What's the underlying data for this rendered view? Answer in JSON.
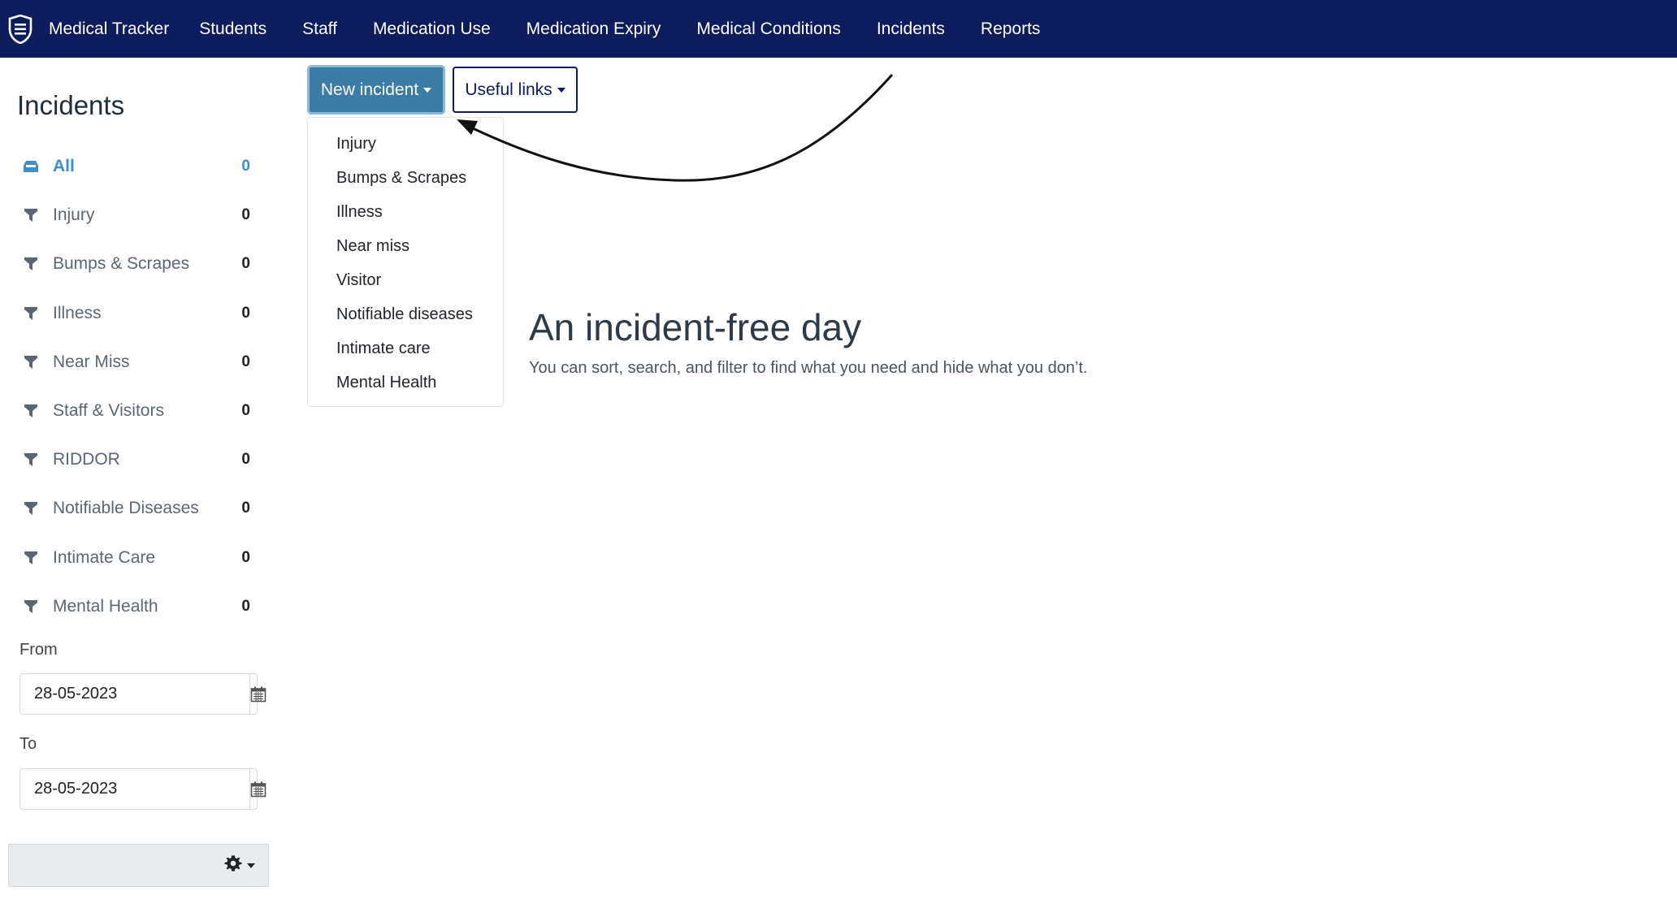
{
  "navbar": {
    "brand": "Medical Tracker",
    "items": [
      "Students",
      "Staff",
      "Medication Use",
      "Medication Expiry",
      "Medical Conditions",
      "Incidents",
      "Reports"
    ]
  },
  "sidebar": {
    "title": "Incidents",
    "filters": [
      {
        "label": "All",
        "count": "0",
        "icon": "inbox-icon"
      },
      {
        "label": "Injury",
        "count": "0",
        "icon": "filter-icon"
      },
      {
        "label": "Bumps & Scrapes",
        "count": "0",
        "icon": "filter-icon"
      },
      {
        "label": "Illness",
        "count": "0",
        "icon": "filter-icon"
      },
      {
        "label": "Near Miss",
        "count": "0",
        "icon": "filter-icon"
      },
      {
        "label": "Staff & Visitors",
        "count": "0",
        "icon": "filter-icon"
      },
      {
        "label": "RIDDOR",
        "count": "0",
        "icon": "filter-icon"
      },
      {
        "label": "Notifiable Diseases",
        "count": "0",
        "icon": "filter-icon"
      },
      {
        "label": "Intimate Care",
        "count": "0",
        "icon": "filter-icon"
      },
      {
        "label": "Mental Health",
        "count": "0",
        "icon": "filter-icon"
      }
    ],
    "from_label": "From",
    "from_value": "28-05-2023",
    "to_label": "To",
    "to_value": "28-05-2023"
  },
  "toolbar": {
    "new_incident_label": "New incident",
    "useful_links_label": "Useful links"
  },
  "dropdown": {
    "items": [
      "Injury",
      "Bumps & Scrapes",
      "Illness",
      "Near miss",
      "Visitor",
      "Notifiable diseases",
      "Intimate care",
      "Mental Health"
    ]
  },
  "empty_state": {
    "title": "An incident-free day",
    "text": "You can sort, search, and filter to find what you need and hide what you don’t."
  },
  "colors": {
    "navbar": "#0c1c5c",
    "accent": "#3d8fc9",
    "primary_button": "#3a7ca5"
  }
}
